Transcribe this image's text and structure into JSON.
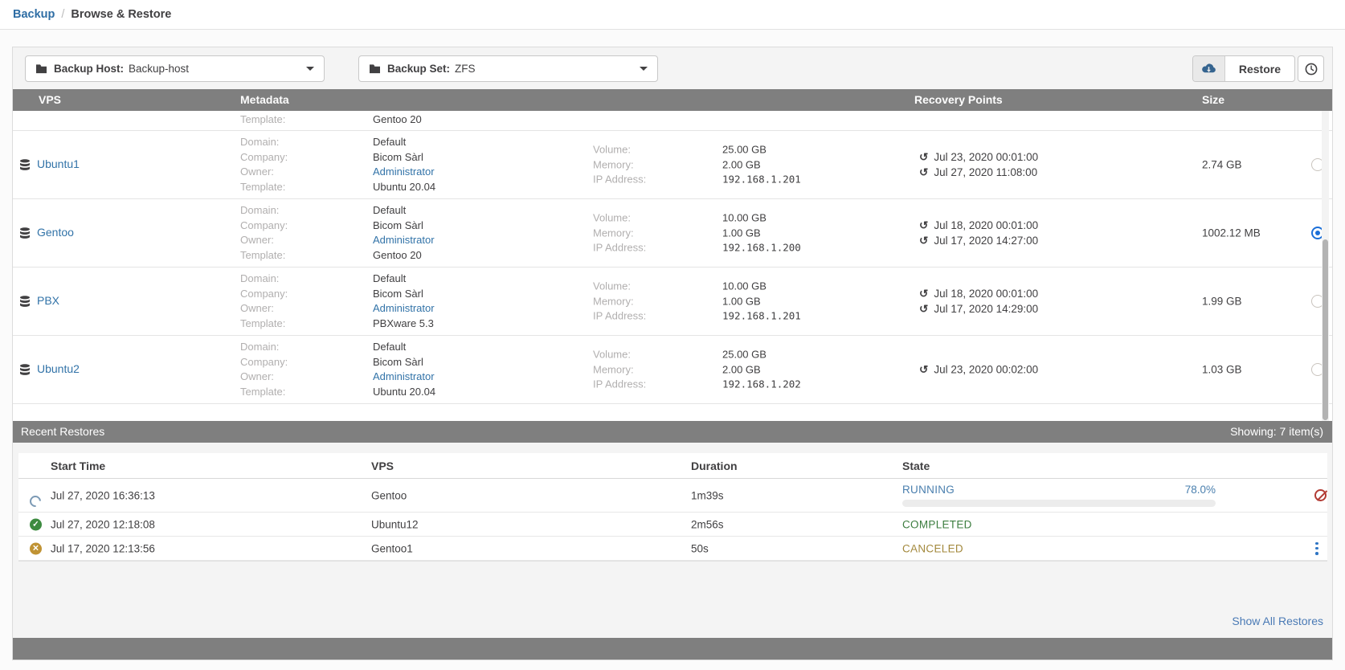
{
  "colors": {
    "header_grey": "#7f7f7f",
    "link_blue": "#3273a8",
    "radio_checked_blue": "#1b6fd8",
    "running_blue": "#4a7fae",
    "completed_green": "#3c7d3f",
    "canceled_amber": "#a3893d",
    "cancel_red": "#b23b34",
    "progress_fill_blue": "#3a6b99"
  },
  "breadcrumb": {
    "backup": "Backup",
    "separator": "/",
    "current": "Browse & Restore"
  },
  "toolbar": {
    "backup_host_label": "Backup Host:",
    "backup_host_value": "Backup-host",
    "backup_set_label": "Backup Set:",
    "backup_set_value": "ZFS",
    "restore_button": "Restore"
  },
  "vps_table": {
    "headers": {
      "vps": "VPS",
      "metadata": "Metadata",
      "recovery_points": "Recovery Points",
      "size": "Size"
    },
    "partial_row": {
      "label": "Template:",
      "value": "Gentoo 20"
    },
    "rows": [
      {
        "name": "Ubuntu1",
        "meta": {
          "domain_label": "Domain:",
          "domain": "Default",
          "company_label": "Company:",
          "company": "Bicom Sàrl",
          "owner_label": "Owner:",
          "owner": "Administrator",
          "template_label": "Template:",
          "template": "Ubuntu 20.04"
        },
        "specs": {
          "volume_label": "Volume:",
          "volume": "25.00 GB",
          "memory_label": "Memory:",
          "memory": "2.00 GB",
          "ip_label": "IP Address:",
          "ip": "192.168.1.201"
        },
        "recovery_points": [
          "Jul 23, 2020 00:01:00",
          "Jul 27, 2020 11:08:00"
        ],
        "size": "2.74 GB"
      },
      {
        "name": "Gentoo",
        "meta": {
          "domain_label": "Domain:",
          "domain": "Default",
          "company_label": "Company:",
          "company": "Bicom Sàrl",
          "owner_label": "Owner:",
          "owner": "Administrator",
          "template_label": "Template:",
          "template": "Gentoo 20"
        },
        "specs": {
          "volume_label": "Volume:",
          "volume": "10.00 GB",
          "memory_label": "Memory:",
          "memory": "1.00 GB",
          "ip_label": "IP Address:",
          "ip": "192.168.1.200"
        },
        "recovery_points": [
          "Jul 18, 2020 00:01:00",
          "Jul 17, 2020 14:27:00"
        ],
        "size": "1002.12 MB"
      },
      {
        "name": "PBX",
        "meta": {
          "domain_label": "Domain:",
          "domain": "Default",
          "company_label": "Company:",
          "company": "Bicom Sàrl",
          "owner_label": "Owner:",
          "owner": "Administrator",
          "template_label": "Template:",
          "template": "PBXware 5.3"
        },
        "specs": {
          "volume_label": "Volume:",
          "volume": "10.00 GB",
          "memory_label": "Memory:",
          "memory": "1.00 GB",
          "ip_label": "IP Address:",
          "ip": "192.168.1.201"
        },
        "recovery_points": [
          "Jul 18, 2020 00:01:00",
          "Jul 17, 2020 14:29:00"
        ],
        "size": "1.99 GB"
      },
      {
        "name": "Ubuntu2",
        "meta": {
          "domain_label": "Domain:",
          "domain": "Default",
          "company_label": "Company:",
          "company": "Bicom Sàrl",
          "owner_label": "Owner:",
          "owner": "Administrator",
          "template_label": "Template:",
          "template": "Ubuntu 20.04"
        },
        "specs": {
          "volume_label": "Volume:",
          "volume": "25.00 GB",
          "memory_label": "Memory:",
          "memory": "2.00 GB",
          "ip_label": "IP Address:",
          "ip": "192.168.1.202"
        },
        "recovery_points": [
          "Jul 23, 2020 00:02:00"
        ],
        "size": "1.03 GB"
      }
    ]
  },
  "recent_restores": {
    "title": "Recent Restores",
    "showing": "Showing: 7 item(s)",
    "headers": {
      "start_time": "Start Time",
      "vps": "VPS",
      "duration": "Duration",
      "state": "State"
    },
    "rows": [
      {
        "start": "Jul 27, 2020 16:36:13",
        "vps": "Gentoo",
        "duration": "1m39s",
        "state": "RUNNING",
        "progress": "78.0%",
        "status": "running"
      },
      {
        "start": "Jul 27, 2020 12:18:08",
        "vps": "Ubuntu12",
        "duration": "2m56s",
        "state": "COMPLETED",
        "status": "completed"
      },
      {
        "start": "Jul 17, 2020 12:13:56",
        "vps": "Gentoo1",
        "duration": "50s",
        "state": "CANCELED",
        "status": "canceled"
      }
    ],
    "show_all": "Show All Restores"
  }
}
